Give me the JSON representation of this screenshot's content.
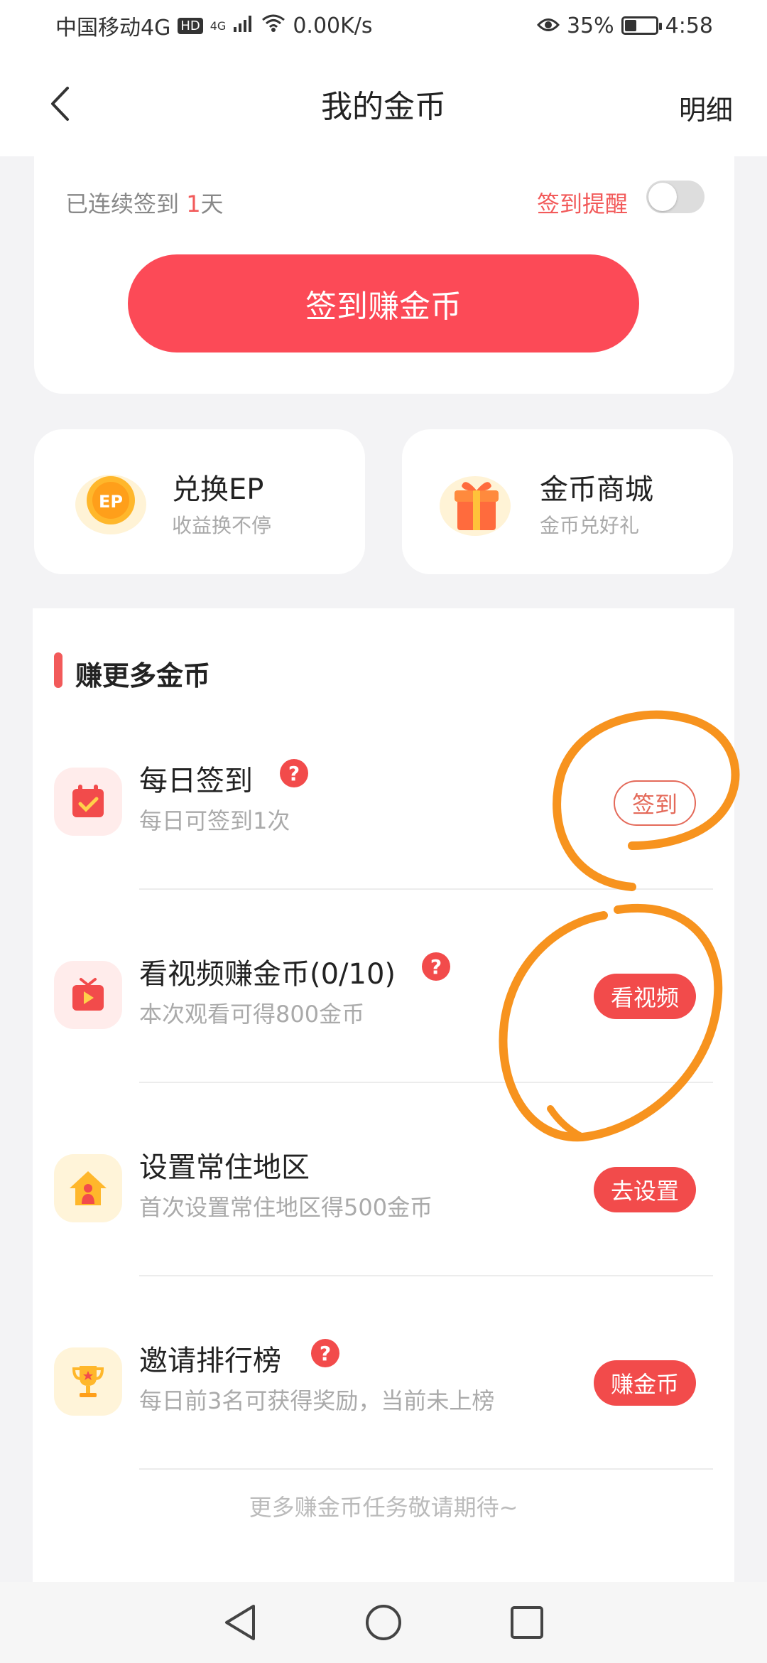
{
  "status_bar": {
    "carrier": "中国移动4G",
    "hd_badge": "HD",
    "net_type": "4G",
    "speed": "0.00K/s",
    "battery": "35%",
    "time": "4:58"
  },
  "nav": {
    "title": "我的金币",
    "detail": "明细"
  },
  "checkin": {
    "streak_prefix": "已连续签到 ",
    "streak_days": "1",
    "streak_suffix": "天",
    "reminder_label": "签到提醒",
    "reminder_on": false,
    "button_label": "签到赚金币"
  },
  "shortcuts": [
    {
      "icon": "ep-coin-icon",
      "title": "兑换EP",
      "subtitle": "收益换不停"
    },
    {
      "icon": "gift-box-icon",
      "title": "金币商城",
      "subtitle": "金币兑好礼"
    }
  ],
  "tasks_section": {
    "title": "赚更多金币",
    "tasks": [
      {
        "icon": "calendar-check-icon",
        "name": "每日签到",
        "has_help": true,
        "desc": "每日可签到1次",
        "button": "签到",
        "button_style": "outline"
      },
      {
        "icon": "tv-play-icon",
        "name": "看视频赚金币(0/10)",
        "has_help": true,
        "desc": "本次观看可得800金币",
        "button": "看视频",
        "button_style": "filled"
      },
      {
        "icon": "home-person-icon",
        "name": "设置常住地区",
        "has_help": false,
        "desc": "首次设置常住地区得500金币",
        "button": "去设置",
        "button_style": "filled"
      },
      {
        "icon": "trophy-icon",
        "name": "邀请排行榜",
        "has_help": true,
        "desc": "每日前3名可获得奖励，当前未上榜",
        "button": "赚金币",
        "button_style": "filled"
      }
    ],
    "footer_note": "更多赚金币任务敬请期待~"
  },
  "colors": {
    "accent_red": "#fc4a57",
    "annotation_orange": "#f7931e"
  }
}
